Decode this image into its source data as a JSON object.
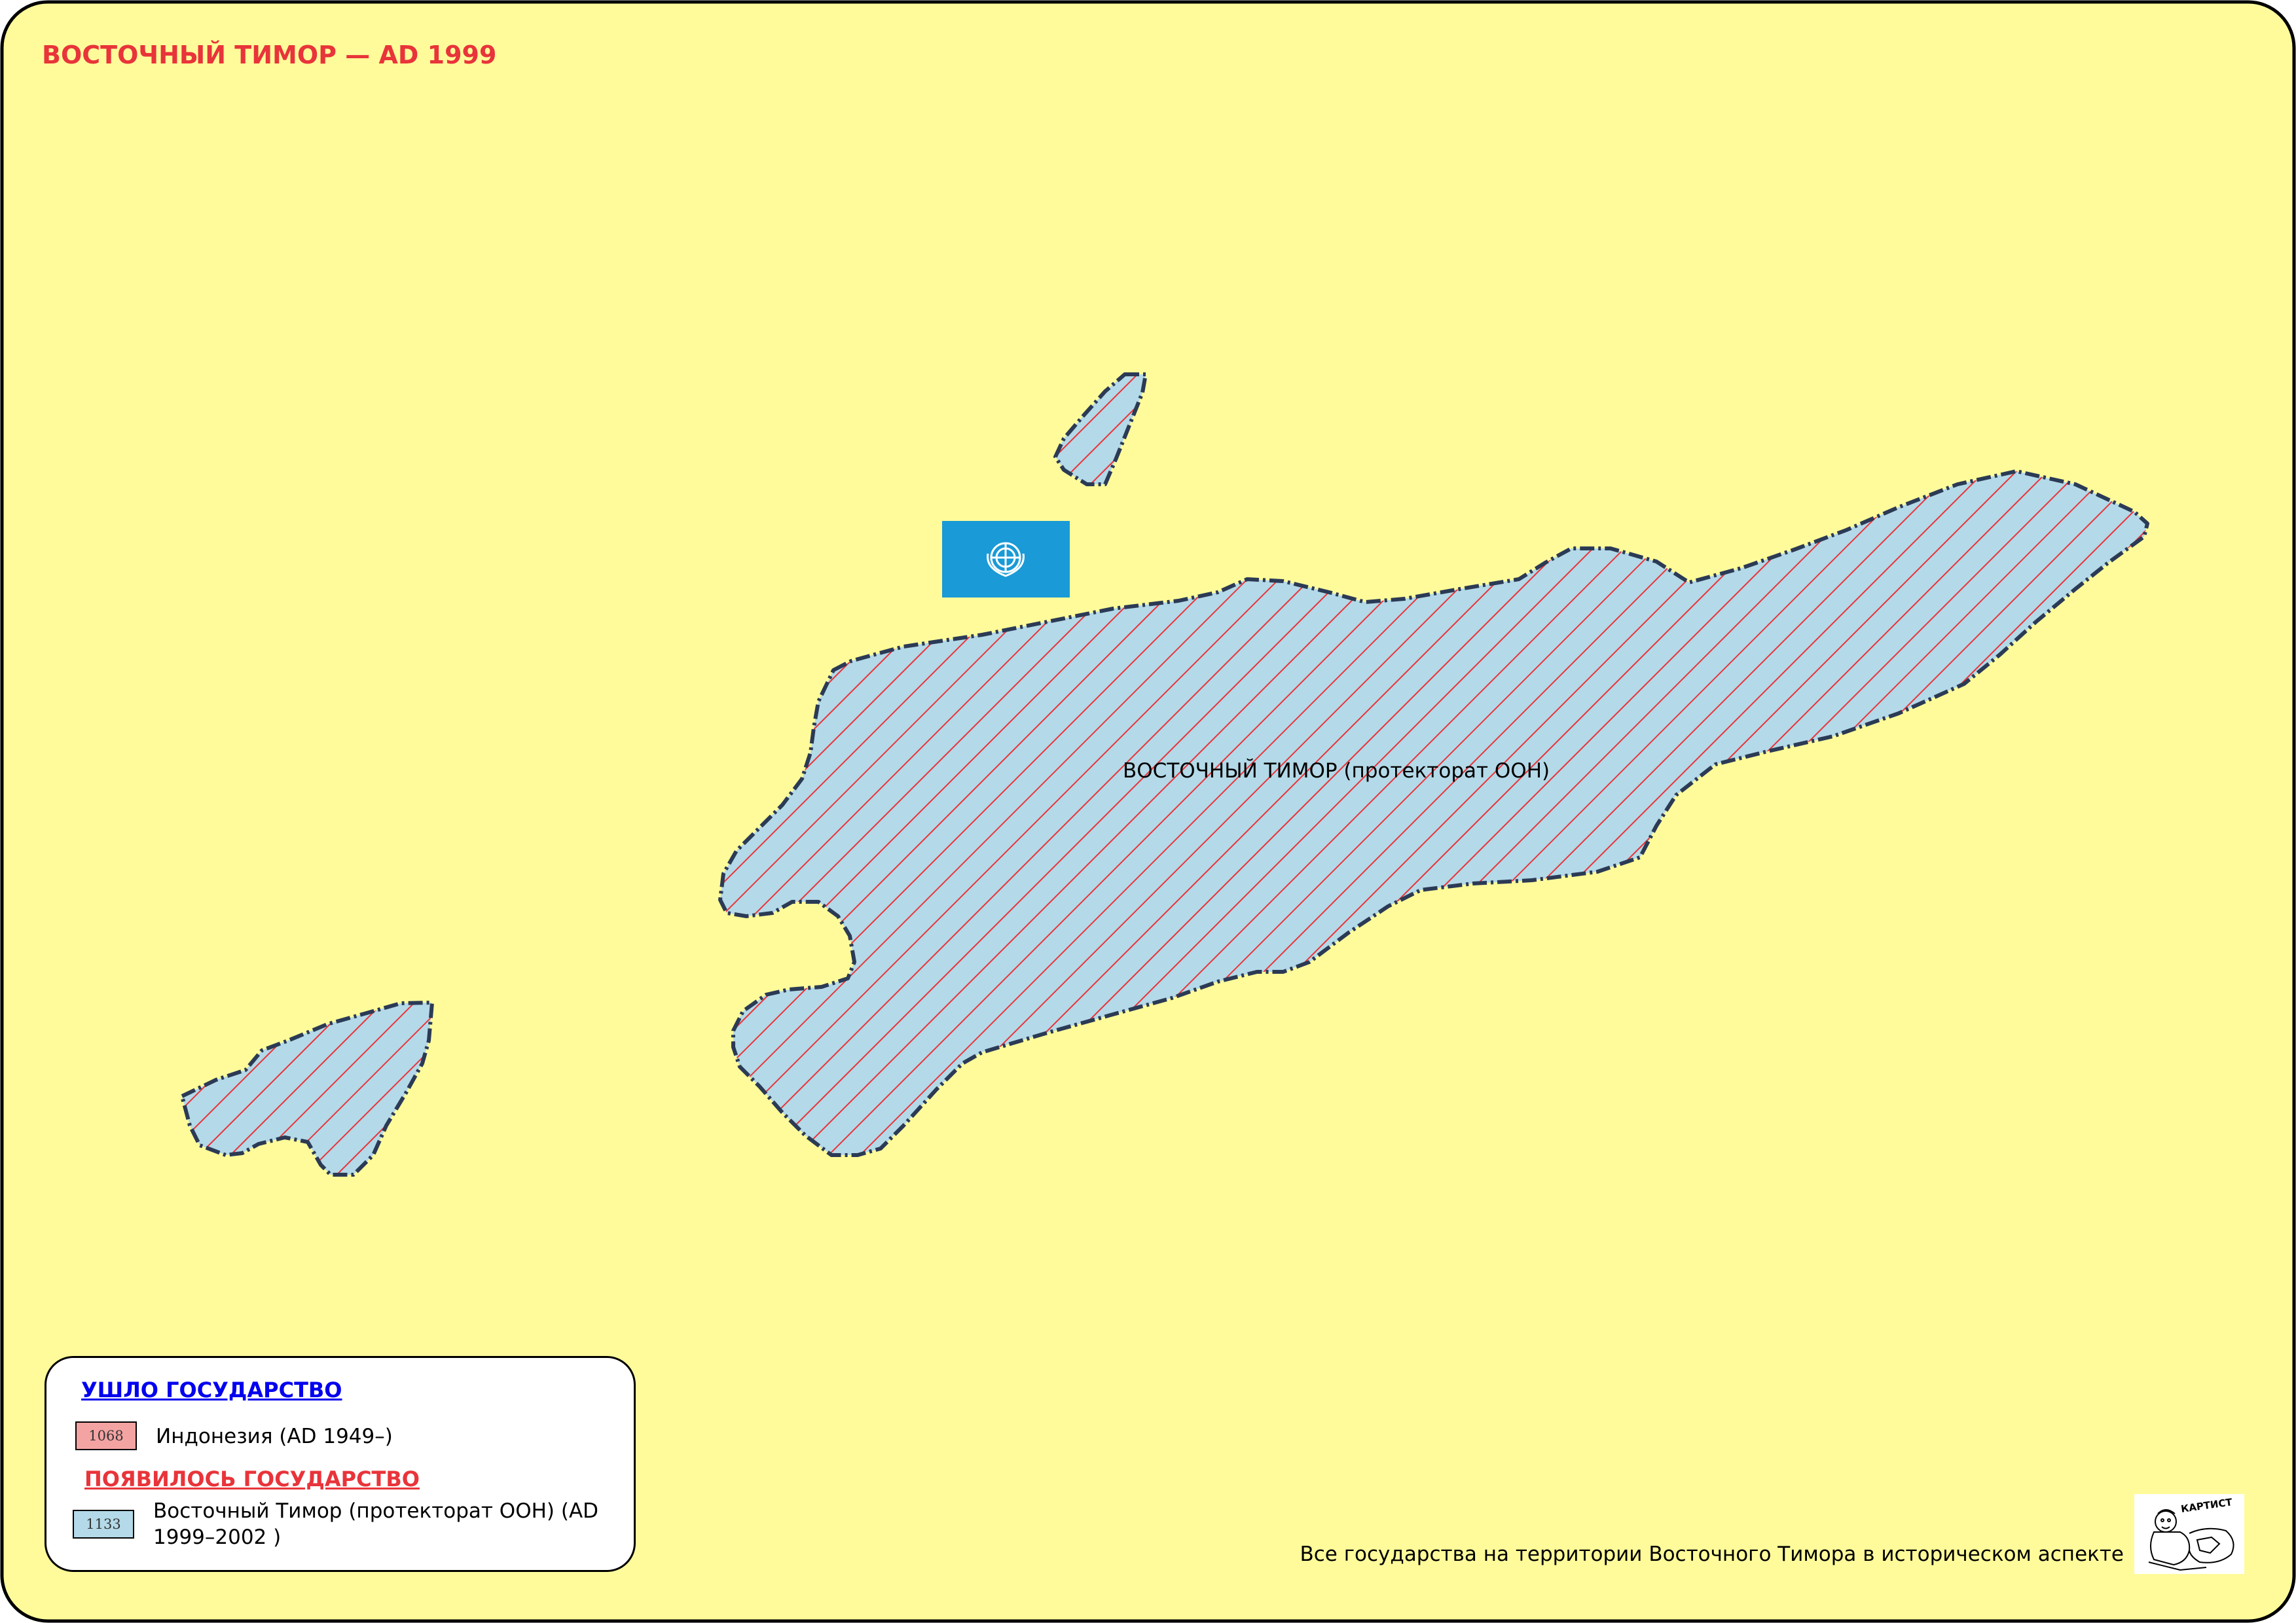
{
  "map": {
    "title": "ВОСТОЧНЫЙ ТИМОР — AD 1999",
    "region_label": "ВОСТОЧНЫЙ ТИМОР (протекторат ООН)",
    "background_color": "#fffb9a",
    "land_fill_color": "#b4d9e8",
    "hatch_color": "#e8343a",
    "border_color": "#2b3a55",
    "flag": {
      "name": "un-flag-icon",
      "color": "#1a9ad6"
    }
  },
  "legend": {
    "gone_heading": "УШЛО ГОСУДАРСТВО",
    "gone_heading_color": "#0000ee",
    "appeared_heading": "ПОЯВИЛОСЬ ГОСУДАРСТВО",
    "appeared_heading_color": "#e8343a",
    "items": [
      {
        "code": "1068",
        "label": "Индонезия (AD 1949–)",
        "color": "#f4a3a3"
      },
      {
        "code": "1133",
        "label": "Восточный Тимор (протекторат ООН) (AD 1999–2002 )",
        "color": "#b4d9e8"
      }
    ]
  },
  "footer": {
    "caption": "Все государства на территории Восточного Тимора в историческом аспекте",
    "logo_text": "КАРТИСТ"
  }
}
